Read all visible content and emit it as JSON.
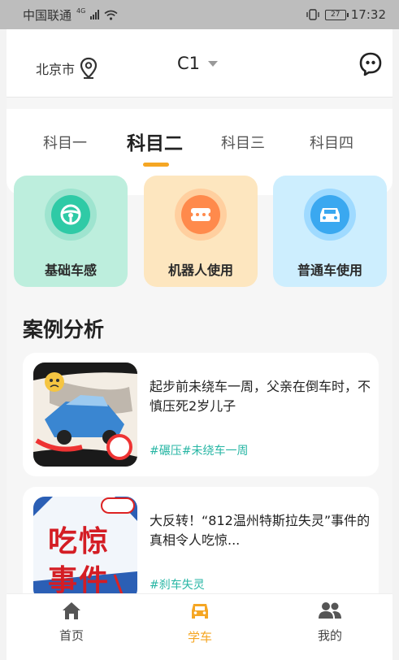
{
  "status_bar": {
    "carrier": "中国联通",
    "network": "4G",
    "battery": "27",
    "time": "17:32"
  },
  "header": {
    "city": "北京市",
    "license_type": "C1",
    "icons": [
      "location-pin-icon",
      "chat-bubble-icon",
      "caret-down-icon"
    ]
  },
  "tabs": [
    {
      "label": "科目一",
      "active": false
    },
    {
      "label": "科目二",
      "active": true
    },
    {
      "label": "科目三",
      "active": false
    },
    {
      "label": "科目四",
      "active": false
    }
  ],
  "features": [
    {
      "label": "基础车感",
      "icon": "steering-wheel-icon",
      "bg": "#bdeedd",
      "circle": "#2fcaa6"
    },
    {
      "label": "机器人使用",
      "icon": "robot-icon",
      "bg": "#fde6bf",
      "circle": "#ff8a4c"
    },
    {
      "label": "普通车使用",
      "icon": "car-icon",
      "bg": "#cdeefe",
      "circle": "#3aa8f0"
    }
  ],
  "section": {
    "title": "案例分析"
  },
  "cases": [
    {
      "title": "起步前未绕车一周，父亲在倒车时，不慎压死2岁儿子",
      "tags": "#碾压#未绕车一周"
    },
    {
      "title": "大反转！“812温州特斯拉失灵”事件的真相令人吃惊...",
      "tags": "#刹车失灵",
      "thumb_text": [
        "吃惊",
        "事件"
      ]
    }
  ],
  "bottom_nav": [
    {
      "label": "首页",
      "icon": "home-icon",
      "active": false
    },
    {
      "label": "学车",
      "icon": "car-front-icon",
      "active": true
    },
    {
      "label": "我的",
      "icon": "people-icon",
      "active": false
    }
  ],
  "colors": {
    "accent": "#f5a623",
    "tag": "#27b6a4"
  }
}
